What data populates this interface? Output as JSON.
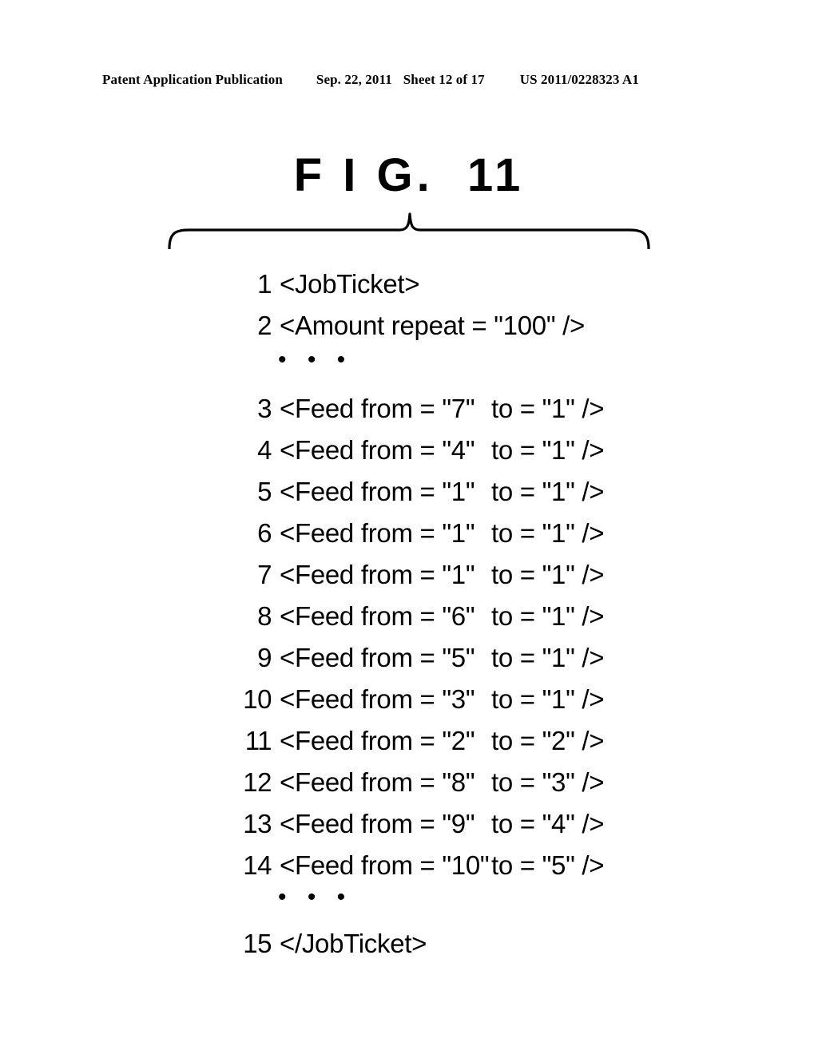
{
  "header": {
    "publication": "Patent Application Publication",
    "date": "Sep. 22, 2011",
    "sheet": "Sheet 12 of 17",
    "doc_number": "US 2011/0228323 A1"
  },
  "figure": {
    "title": "F I G.  11"
  },
  "code": {
    "ellipsis": "• • •",
    "lines": [
      {
        "num": "1",
        "text": "<JobTicket>",
        "col_a": "",
        "col_b": ""
      },
      {
        "num": "2",
        "text": "<Amount repeat = \"100\" />",
        "col_a": "",
        "col_b": ""
      },
      {
        "num": "3",
        "text": "",
        "col_a": "<Feed from = \"7\"",
        "col_b": "to = \"1\" />"
      },
      {
        "num": "4",
        "text": "",
        "col_a": "<Feed from = \"4\"",
        "col_b": "to = \"1\" />"
      },
      {
        "num": "5",
        "text": "",
        "col_a": "<Feed from = \"1\"",
        "col_b": "to = \"1\" />"
      },
      {
        "num": "6",
        "text": "",
        "col_a": "<Feed from = \"1\"",
        "col_b": "to = \"1\" />"
      },
      {
        "num": "7",
        "text": "",
        "col_a": "<Feed from = \"1\"",
        "col_b": "to = \"1\" />"
      },
      {
        "num": "8",
        "text": "",
        "col_a": "<Feed from = \"6\"",
        "col_b": "to = \"1\" />"
      },
      {
        "num": "9",
        "text": "",
        "col_a": "<Feed from = \"5\"",
        "col_b": "to = \"1\" />"
      },
      {
        "num": "10",
        "text": "",
        "col_a": "<Feed from = \"3\"",
        "col_b": "to = \"1\" />"
      },
      {
        "num": "11",
        "text": "",
        "col_a": "<Feed from = \"2\"",
        "col_b": "to = \"2\" />"
      },
      {
        "num": "12",
        "text": "",
        "col_a": "<Feed from = \"8\"",
        "col_b": "to = \"3\" />"
      },
      {
        "num": "13",
        "text": "",
        "col_a": "<Feed from = \"9\"",
        "col_b": "to = \"4\" />"
      },
      {
        "num": "14",
        "text": "",
        "col_a": "<Feed from = \"10\"",
        "col_b": "to = \"5\" />"
      },
      {
        "num": "15",
        "text": "</JobTicket>",
        "col_a": "",
        "col_b": ""
      }
    ]
  }
}
